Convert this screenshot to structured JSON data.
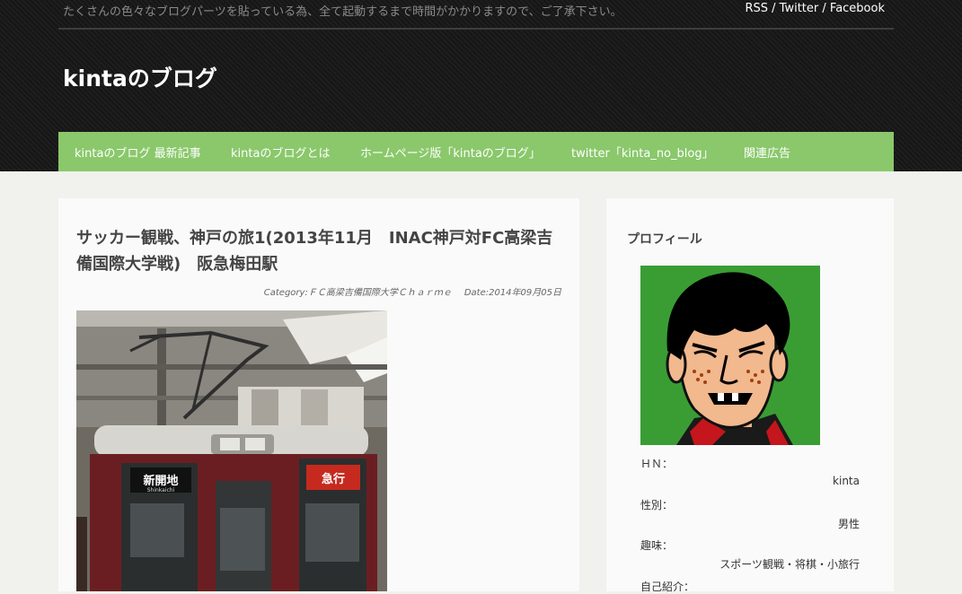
{
  "header": {
    "notice": "たくさんの色々なブログパーツを貼っている為、全て起動するまで時間がかかりますので、ご了承下さい。",
    "links": [
      "RSS",
      "Twitter",
      "Facebook"
    ],
    "separator": " / ",
    "site_title": "kintaのブログ"
  },
  "nav": {
    "items": [
      "kintaのブログ 最新記事",
      "kintaのブログとは",
      "ホームページ版「kintaのブログ」",
      "twitter「kinta_no_blog」",
      "関連広告"
    ]
  },
  "post": {
    "title": "サッカー観戦、神戸の旅1(2013年11月　INAC神戸対FC高梁吉備国際大学戦)　阪急梅田駅",
    "category": "Category:ＦＣ高梁吉備国際大学Ｃｈａｒｍｅ",
    "date": "Date:2014年09月05日",
    "photo_destination": "新開地",
    "photo_destination_romaji": "Shinkaichi",
    "photo_type": "急行"
  },
  "sidebar": {
    "title": "プロフィール",
    "profile": [
      {
        "label": "ＨＮ：",
        "value": "kinta"
      },
      {
        "label": "性別：",
        "value": "男性"
      },
      {
        "label": "趣味：",
        "value": "スポーツ観戦・将棋・小旅行"
      },
      {
        "label": "自己紹介：",
        "value": ""
      }
    ]
  }
}
